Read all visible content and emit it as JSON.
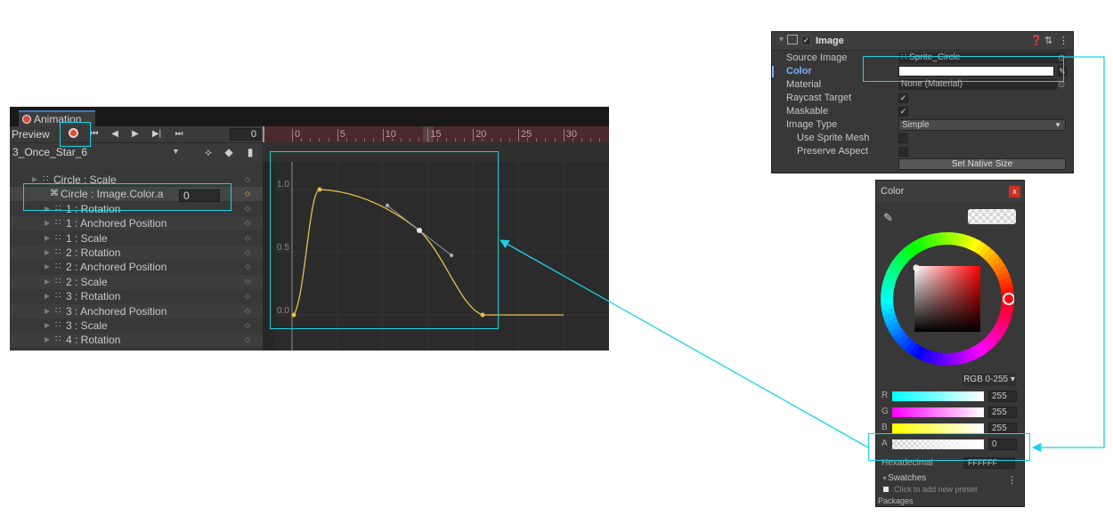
{
  "animation": {
    "tab_title": "Animation",
    "preview_label": "Preview",
    "frame_value": "0",
    "clip_name": "3_Once_Star_6",
    "ruler_labels": [
      "0",
      "5",
      "10",
      "15",
      "20",
      "25",
      "30"
    ],
    "curve_y_labels": [
      "1.0",
      "0.5",
      "0.0"
    ],
    "alpha_value": "0",
    "properties": [
      {
        "label": "Circle : Scale",
        "indent": 1,
        "selected": false
      },
      {
        "label": "Circle : Image.Color.a",
        "indent": 2,
        "selected": true
      },
      {
        "label": "1 : Rotation",
        "indent": 3,
        "selected": false
      },
      {
        "label": "1 : Anchored Position",
        "indent": 3,
        "selected": false
      },
      {
        "label": "1 : Scale",
        "indent": 3,
        "selected": false
      },
      {
        "label": "2 : Rotation",
        "indent": 3,
        "selected": false
      },
      {
        "label": "2 : Anchored Position",
        "indent": 3,
        "selected": false
      },
      {
        "label": "2 : Scale",
        "indent": 3,
        "selected": false
      },
      {
        "label": "3 : Rotation",
        "indent": 3,
        "selected": false
      },
      {
        "label": "3 : Anchored Position",
        "indent": 3,
        "selected": false
      },
      {
        "label": "3 : Scale",
        "indent": 3,
        "selected": false
      },
      {
        "label": "4 : Rotation",
        "indent": 3,
        "selected": false
      }
    ]
  },
  "inspector": {
    "component_title": "Image",
    "rows": {
      "source_image": {
        "label": "Source Image",
        "value": "Sprite_Circle"
      },
      "color": {
        "label": "Color"
      },
      "material": {
        "label": "Material",
        "value": "None (Material)"
      },
      "raycast_target": {
        "label": "Raycast Target"
      },
      "maskable": {
        "label": "Maskable"
      },
      "image_type": {
        "label": "Image Type",
        "value": "Simple"
      },
      "use_sprite_mesh": {
        "label": "Use Sprite Mesh"
      },
      "preserve_aspect": {
        "label": "Preserve Aspect"
      }
    },
    "native_size_button": "Set Native Size"
  },
  "color_picker": {
    "title": "Color",
    "close_label": "x",
    "mode_label": "RGB 0-255 ▾",
    "channels": [
      {
        "name": "R",
        "value": "255"
      },
      {
        "name": "G",
        "value": "255"
      },
      {
        "name": "B",
        "value": "255"
      },
      {
        "name": "A",
        "value": "0"
      }
    ],
    "hex_label": "Hexadecimal",
    "hex_value": "FFFFFF",
    "swatches_label": "Swatches",
    "swatches_hint": "Click to add new preset",
    "footer_label": "Packages"
  },
  "colors": {
    "highlight": "#19d4e6",
    "record_red": "#e04a3f",
    "curve": "#e6c24a",
    "accent_blue": "#7ab0ff"
  }
}
